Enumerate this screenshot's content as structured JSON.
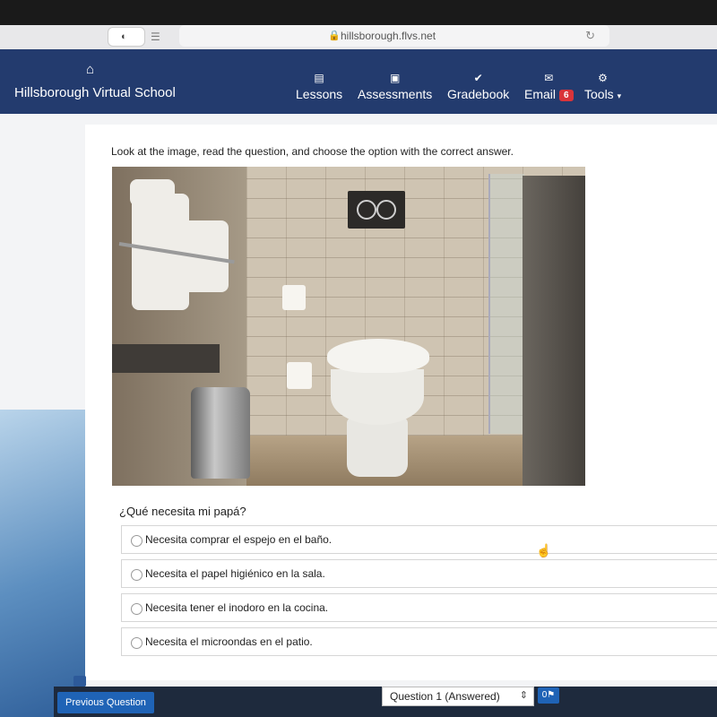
{
  "browser": {
    "url": "hillsborough.flvs.net",
    "shield_icon": "shield-icon",
    "reload_icon": "reload-icon"
  },
  "navbar": {
    "school_name": "Hillsborough Virtual School",
    "items": [
      {
        "label": "Lessons",
        "icon": "book-icon"
      },
      {
        "label": "Assessments",
        "icon": "inbox-icon"
      },
      {
        "label": "Gradebook",
        "icon": "check-icon"
      },
      {
        "label": "Email",
        "icon": "envelope-icon",
        "badge": "6"
      },
      {
        "label": "Tools",
        "icon": "gear-icon"
      }
    ],
    "color": "#233b6e",
    "badge_color": "#d9343a"
  },
  "main": {
    "instruction": "Look at the image, read the question, and choose the option with the correct answer.",
    "question": "¿Qué necesita mi papá?",
    "options": [
      {
        "label": "Necesita comprar el espejo en el baño."
      },
      {
        "label": "Necesita el papel higiénico en la sala."
      },
      {
        "label": "Necesita tener el inodoro en la cocina."
      },
      {
        "label": "Necesita el microondas en el patio."
      }
    ]
  },
  "footer": {
    "previous_label": "Previous Question",
    "question_select": "Question 1 (Answered)",
    "flag_label": "0",
    "accent": "#1f63b6"
  }
}
